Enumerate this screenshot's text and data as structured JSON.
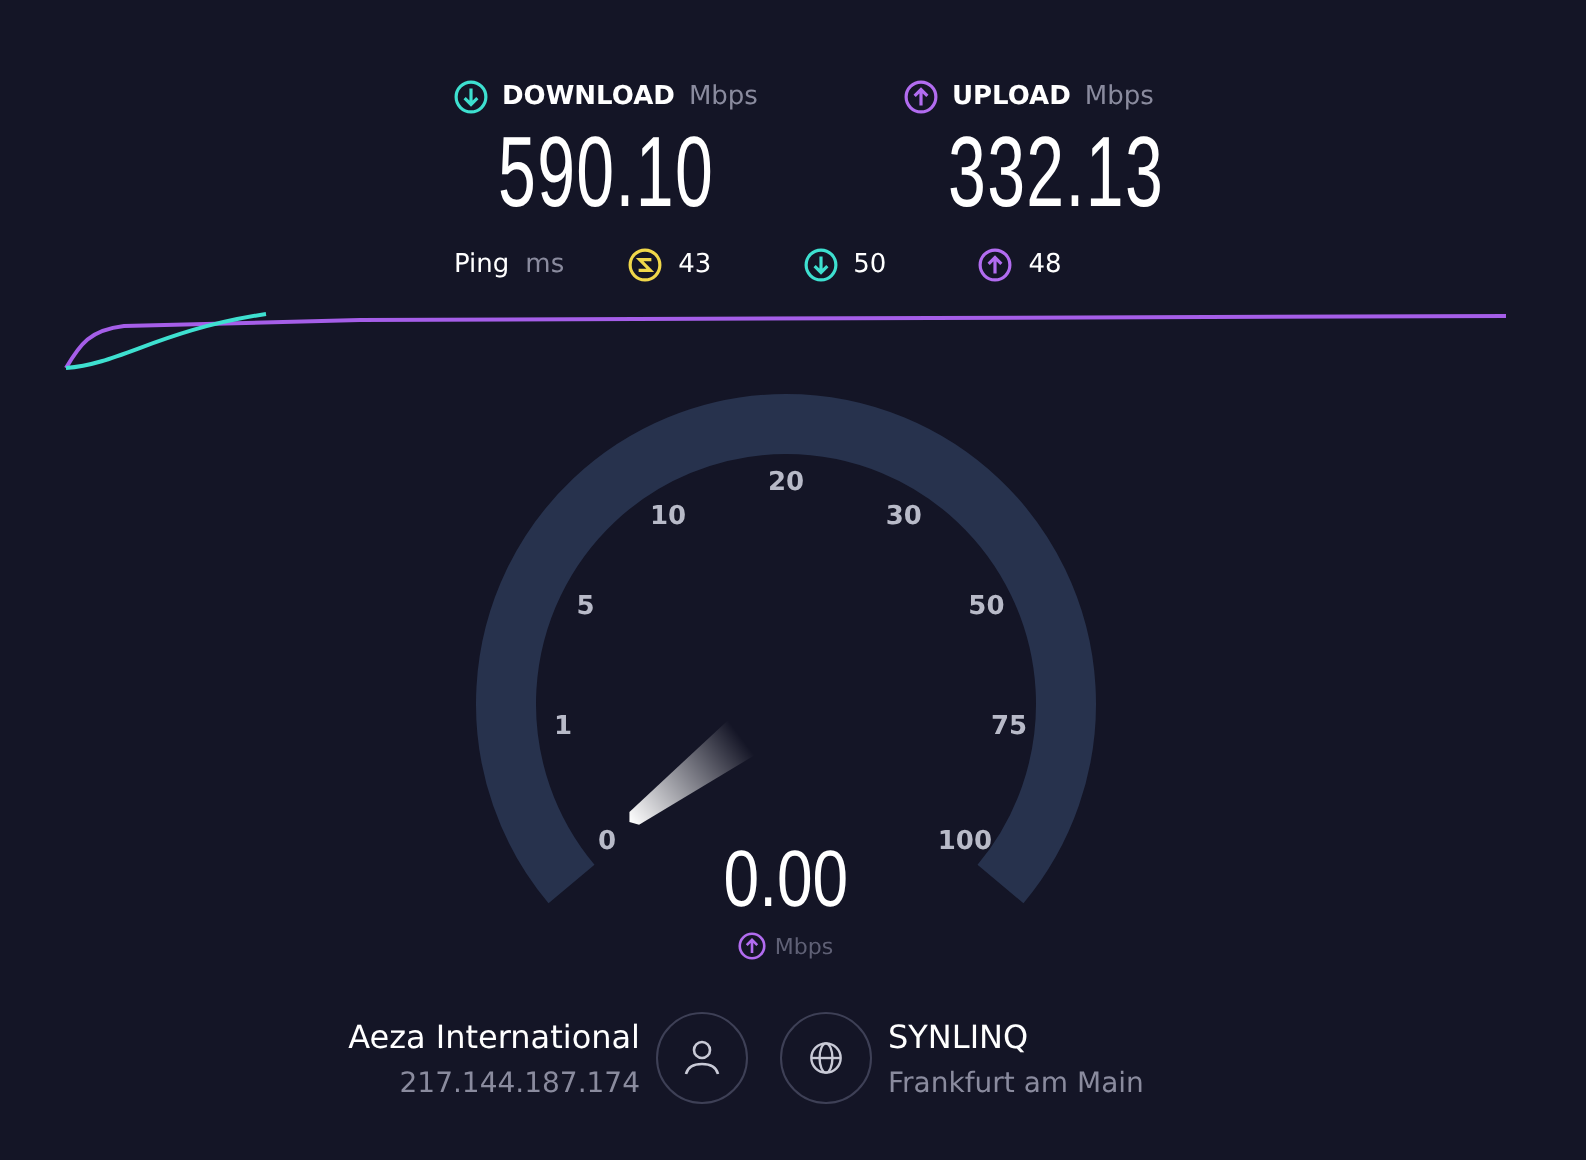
{
  "download": {
    "label": "DOWNLOAD",
    "unit": "Mbps",
    "value": "590.10"
  },
  "upload": {
    "label": "UPLOAD",
    "unit": "Mbps",
    "value": "332.13"
  },
  "ping": {
    "label": "Ping",
    "unit": "ms",
    "items": [
      {
        "kind": "idle",
        "value": "43"
      },
      {
        "kind": "download",
        "value": "50"
      },
      {
        "kind": "upload",
        "value": "48"
      }
    ]
  },
  "gauge": {
    "labels": [
      "0",
      "1",
      "5",
      "10",
      "20",
      "30",
      "50",
      "75",
      "100"
    ],
    "value": "0.00",
    "unit": "Mbps"
  },
  "isp": {
    "name": "Aeza International",
    "ip": "217.144.187.174"
  },
  "server": {
    "name": "SYNLINQ",
    "location": "Frankfurt am Main"
  }
}
